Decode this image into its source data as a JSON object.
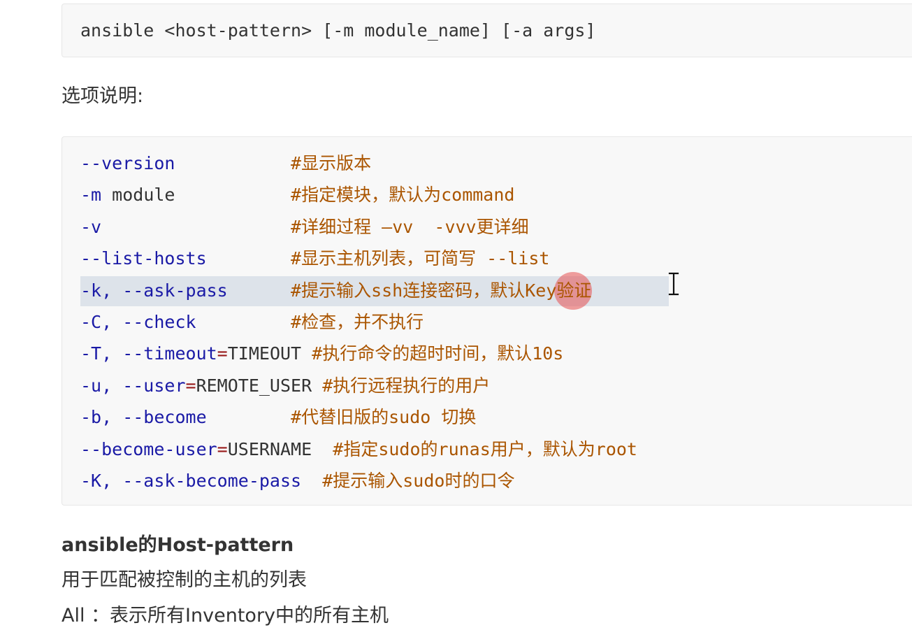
{
  "usage": {
    "command": "ansible <host-pattern> [-m module_name] [-a args]"
  },
  "options_heading": "选项说明:",
  "options": [
    {
      "opt": "--version",
      "eq": "",
      "val": "",
      "pad": "           ",
      "comment": "#显示版本",
      "selected": false
    },
    {
      "opt": "-m",
      "eq": "",
      "val": " module",
      "pad": "           ",
      "comment": "#指定模块，默认为command",
      "selected": false
    },
    {
      "opt": "-v",
      "eq": "",
      "val": "",
      "pad": "                  ",
      "comment": "#详细过程 –vv  -vvv更详细",
      "selected": false
    },
    {
      "opt": "--list-hosts",
      "eq": "",
      "val": "",
      "pad": "        ",
      "comment": "#显示主机列表，可简写 --list",
      "selected": false
    },
    {
      "opt": "-k, --ask-pass",
      "eq": "",
      "val": "",
      "pad": "      ",
      "comment": "#提示输入ssh连接密码，默认Key验证",
      "selected": true
    },
    {
      "opt": "-C, --check",
      "eq": "",
      "val": "",
      "pad": "         ",
      "comment": "#检查，并不执行",
      "selected": false
    },
    {
      "opt": "-T, --timeout",
      "eq": "=",
      "val": "TIMEOUT",
      "pad": " ",
      "comment": "#执行命令的超时时间，默认10s",
      "selected": false
    },
    {
      "opt": "-u, --user",
      "eq": "=",
      "val": "REMOTE_USER",
      "pad": " ",
      "comment": "#执行远程执行的用户",
      "selected": false
    },
    {
      "opt": "-b, --become",
      "eq": "",
      "val": "",
      "pad": "        ",
      "comment": "#代替旧版的sudo 切换",
      "selected": false
    },
    {
      "opt": "--become-user",
      "eq": "=",
      "val": "USERNAME",
      "pad": "  ",
      "comment": "#指定sudo的runas用户，默认为root",
      "selected": false
    },
    {
      "opt": "-K, --ask-become-pass",
      "eq": "",
      "val": "",
      "pad": "  ",
      "comment": "#提示输入sudo时的口令",
      "selected": false
    }
  ],
  "host_pattern": {
    "heading": "ansible的Host-pattern",
    "paragraph_1": "用于匹配被控制的主机的列表",
    "paragraph_2": "All ：表示所有Inventory中的所有主机"
  },
  "colors": {
    "option": "#1a1aa6",
    "equals": "#981a1a",
    "comment": "#aa5500",
    "code_background": "#f8f8f8",
    "selection": "#dde3ea"
  },
  "icons": {
    "pointer": "mouse-click-highlight-icon",
    "text_cursor": "text-cursor-icon"
  }
}
